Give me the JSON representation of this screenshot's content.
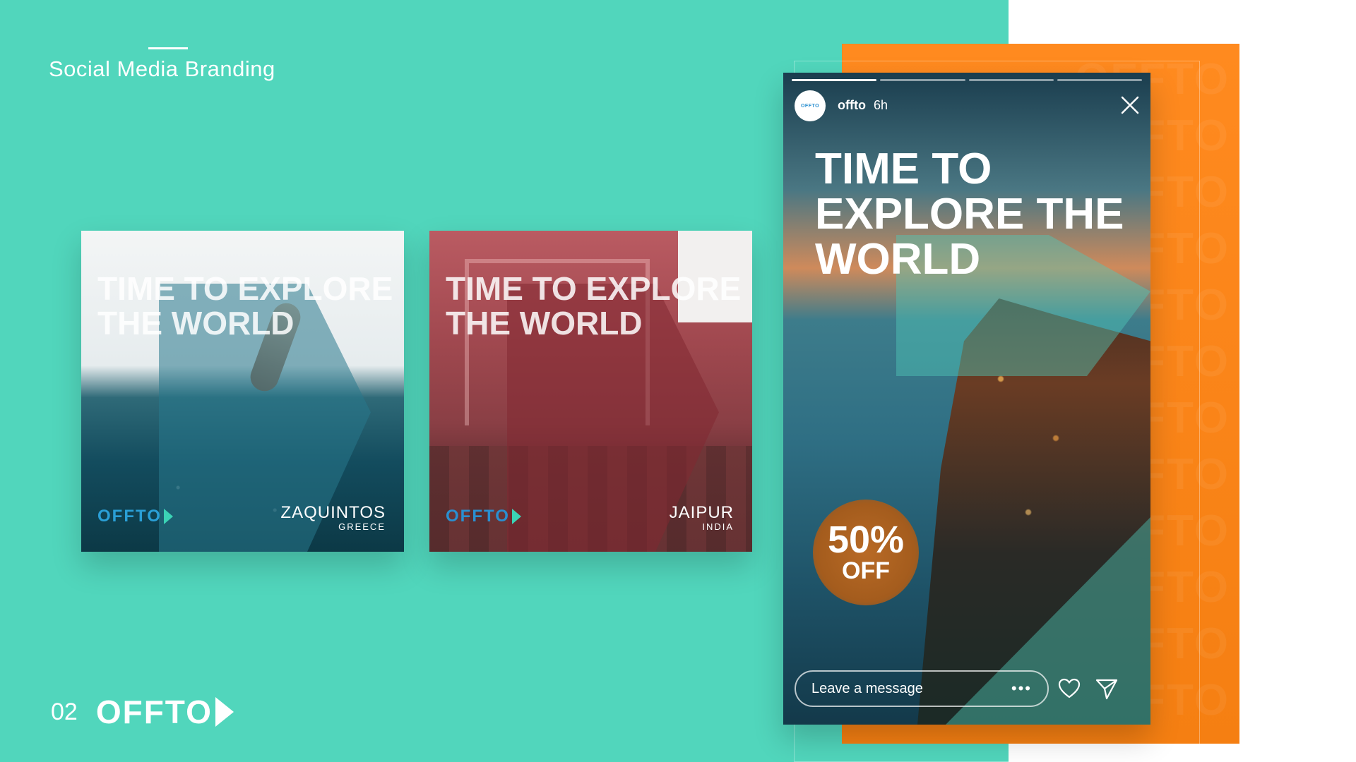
{
  "page": {
    "heading": "Social Media Branding",
    "page_number": "02",
    "brand": "OFFTO"
  },
  "posts": [
    {
      "title": "TIME TO EXPLORE THE WORLD",
      "brand": "OFFTO",
      "place": "ZAQUINTOS",
      "country": "GREECE"
    },
    {
      "title": "TIME TO EXPLORE THE WORLD",
      "brand": "OFFTO",
      "place": "JAIPUR",
      "country": "INDIA"
    }
  ],
  "story": {
    "avatar_label": "OFFTO",
    "username": "offto",
    "time": "6h",
    "title": "TIME TO EXPLORE THE WORLD",
    "discount_percent": "50%",
    "discount_label": "OFF",
    "message_placeholder": "Leave a message",
    "more_label": "•••",
    "progress_segments": 4,
    "active_segment": 1
  },
  "watermark": "OFFTO",
  "colors": {
    "teal": "#51d6bc",
    "orange": "#f57f12",
    "brand_blue": "#2a8fd0"
  },
  "icons": [
    "close-icon",
    "heart-icon",
    "send-icon",
    "more-icon",
    "chevron-right-icon"
  ]
}
